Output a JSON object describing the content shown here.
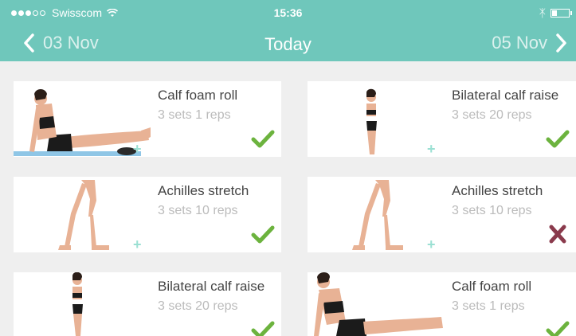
{
  "status_bar": {
    "carrier": "Swisscom",
    "time": "15:36"
  },
  "nav": {
    "prev_date": "03 Nov",
    "title": "Today",
    "next_date": "05 Nov"
  },
  "exercises": [
    {
      "name": "Calf foam roll",
      "detail": "3 sets 1 reps",
      "status": "done"
    },
    {
      "name": "Bilateral calf raise",
      "detail": "3 sets 20 reps",
      "status": "done"
    },
    {
      "name": "Achilles stretch",
      "detail": "3 sets 10 reps",
      "status": "done"
    },
    {
      "name": "Achilles stretch",
      "detail": "3 sets 10 reps",
      "status": "skipped"
    },
    {
      "name": "Bilateral calf raise",
      "detail": "3 sets 20 reps",
      "status": "done"
    },
    {
      "name": "Calf foam roll",
      "detail": "3 sets 1 reps",
      "status": "done"
    }
  ],
  "colors": {
    "header": "#6fc7bb",
    "done": "#6cb33e",
    "skipped": "#8a3a4c",
    "background": "#efefef"
  }
}
